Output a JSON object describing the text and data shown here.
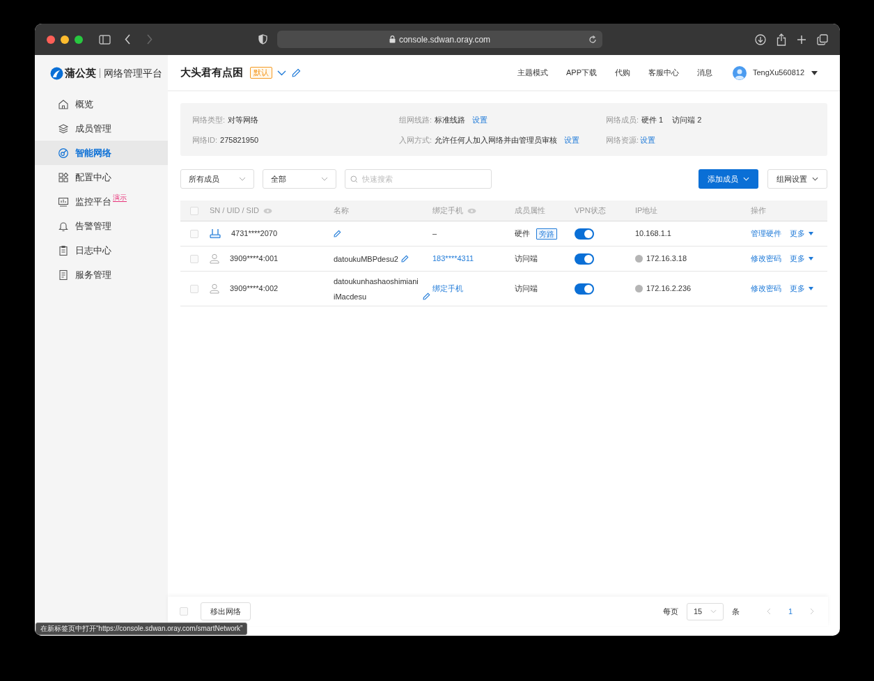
{
  "browser": {
    "url": "console.sdwan.oray.com"
  },
  "brand": {
    "name": "蒲公英",
    "subtitle": "网络管理平台"
  },
  "sidebar": {
    "items": [
      {
        "label": "概览",
        "selected": false
      },
      {
        "label": "成员管理",
        "selected": false
      },
      {
        "label": "智能网络",
        "selected": true
      },
      {
        "label": "配置中心",
        "selected": false
      },
      {
        "label": "监控平台",
        "selected": false,
        "badge": "演示"
      },
      {
        "label": "告警管理",
        "selected": false
      },
      {
        "label": "日志中心",
        "selected": false
      },
      {
        "label": "服务管理",
        "selected": false
      }
    ]
  },
  "header": {
    "network_name": "大头君有点困",
    "tag": "默认",
    "nav": [
      "主题模式",
      "APP下载",
      "代购",
      "客服中心",
      "消息"
    ],
    "user": "TengXu560812"
  },
  "info": [
    {
      "label": "网络类型:",
      "value": "对等网络"
    },
    {
      "label": "组网线路:",
      "value": "标准线路",
      "link": "设置"
    },
    {
      "label": "网络成员:",
      "value": "硬件 1",
      "value2": "访问端 2"
    },
    {
      "label": "网络ID:",
      "value": "275821950"
    },
    {
      "label": "入网方式:",
      "value": "允许任何人加入网络并由管理员审核",
      "link": "设置"
    },
    {
      "label": "网络资源:",
      "link": "设置"
    }
  ],
  "filters": {
    "member_select": "所有成员",
    "type_select": "全部",
    "search": {
      "placeholder": "快速搜索"
    },
    "add_button": "添加成员",
    "settings_button": "组网设置"
  },
  "table": {
    "select_all_checked": false,
    "columns": [
      "SN / UID / SID",
      "名称",
      "绑定手机",
      "成员属性",
      "VPN状态",
      "IP地址",
      "操作"
    ],
    "rows": [
      {
        "kind": "hardware",
        "checked": false,
        "id": "4731****2070",
        "phone": {
          "text": "–",
          "link": false
        },
        "type": "硬件",
        "tag": "旁路",
        "vpn_on": true,
        "ip": "10.168.1.1",
        "action": "管理硬件",
        "more": "更多"
      },
      {
        "kind": "client",
        "checked": false,
        "id": "3909****4:001",
        "name": "datoukuMBPdesu2",
        "phone": {
          "text": "183****4311",
          "link": true
        },
        "type": "访问端",
        "vpn_on": true,
        "ip": "172.16.3.18",
        "action": "修改密码",
        "more": "更多"
      },
      {
        "kind": "client",
        "checked": false,
        "id": "3909****4:002",
        "name": "datoukunhashaoshimianiiMacdesu",
        "phone": {
          "text": "绑定手机",
          "link": true
        },
        "type": "访问端",
        "vpn_on": true,
        "ip": "172.16.2.236",
        "action": "修改密码",
        "more": "更多"
      }
    ]
  },
  "footer": {
    "select_checked": false,
    "remove_button": "移出网络",
    "per_page_label": "每页",
    "per_page": "15",
    "unit": "条",
    "pages": [
      {
        "label": "1",
        "selected": true
      }
    ]
  },
  "status_tooltip": "在新标签页中打开“https://console.sdwan.oray.com/smartNetwork”"
}
